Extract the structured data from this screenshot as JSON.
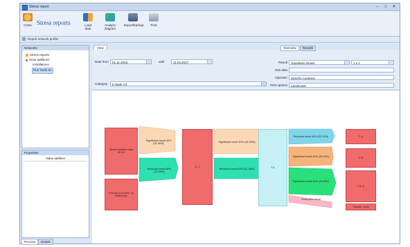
{
  "window": {
    "title": "Stress report",
    "min_glyph": "–",
    "max_glyph": "□",
    "close_glyph": "✕"
  },
  "ribbon": {
    "brand": "Stress reports",
    "buttons": [
      {
        "label": "Close"
      },
      {
        "label": "Load data"
      },
      {
        "label": "Analyze diagram"
      },
      {
        "label": "Export/backup"
      },
      {
        "label": "Print"
      }
    ]
  },
  "quickbar": {
    "label": "Report network profile"
  },
  "sidebar": {
    "tree_header": "Networks",
    "tree_items": [
      {
        "label": "Stress reports"
      },
      {
        "label": "Scan additions"
      },
      {
        "label": "Installations"
      },
      {
        "label": "Run Node 01"
      }
    ],
    "props_header": "Properties",
    "props_col": "Value addition",
    "tabs": [
      "Process",
      "Details"
    ]
  },
  "document": {
    "tab": "View",
    "date_from_label": "Date from",
    "date_from": "01.11.2016",
    "date_to_label": "until",
    "date_to": "11.03.2017",
    "category_label": "Category",
    "category": "E-Mark V2",
    "right_tabs": [
      "Overview",
      "Results"
    ],
    "fields": [
      {
        "label": "Result",
        "value": "Quantities shown",
        "extra": "1 x 2"
      },
      {
        "label": "Sub data",
        "value": ""
      },
      {
        "label": "Operator",
        "value": "Specific Analyses"
      },
      {
        "label": "Print options",
        "value": "Landscape"
      }
    ]
  },
  "diagram": {
    "nodes": [
      {
        "text": "Stress indicator data 60.00"
      },
      {
        "text": "Significant result 40% (31.05%)"
      },
      {
        "text": "Process A (Comm. 3) Reference"
      },
      {
        "text": "Reduced result 80% (22.48%)"
      },
      {
        "text": "A. 1"
      },
      {
        "text": "Significant result 40% (31.05%)"
      },
      {
        "text": "Reduced result 80% (22.48%)"
      },
      {
        "text": "T.4"
      },
      {
        "text": "Reduced result 60% (20.19%)"
      },
      {
        "text": "Significant result 40% (35.40%)"
      },
      {
        "text": "Significant result 40% (29.05%)"
      },
      {
        "text": "Scan prior result"
      },
      {
        "text": "T. A."
      },
      {
        "text": "T. B."
      },
      {
        "text": "T. B. A."
      },
      {
        "text": "Sample result"
      }
    ]
  },
  "colors": {
    "red": "#f06b6b",
    "peach": "#fad7b5",
    "teal": "#2ee0b0",
    "cyan": "#c7f0f4",
    "green": "#29e07a",
    "orange": "#f6b37c",
    "pink": "#f9b9c4",
    "sky": "#7fd6ea"
  }
}
